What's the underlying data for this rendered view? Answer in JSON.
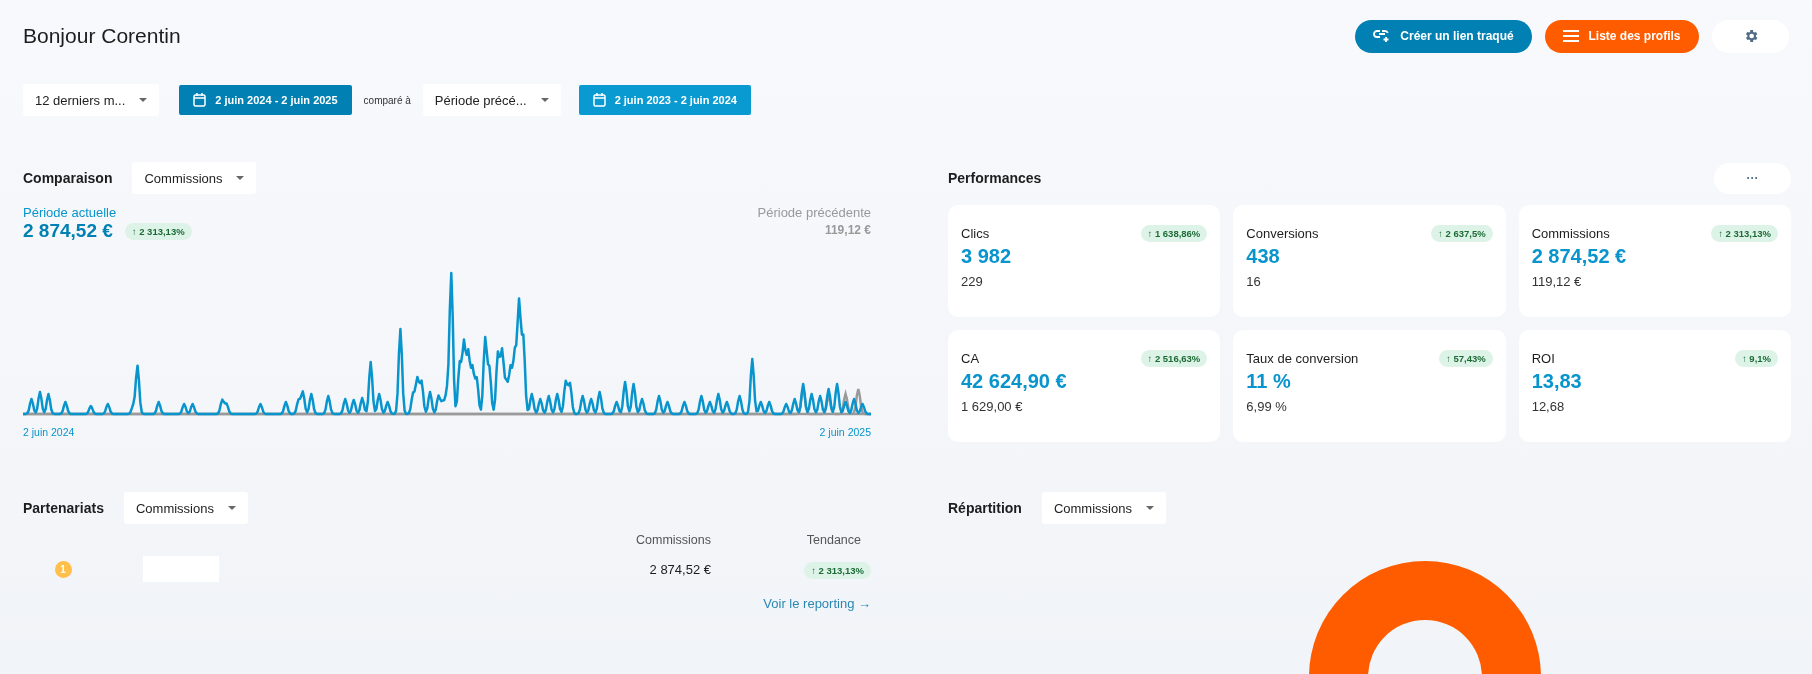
{
  "greeting": "Bonjour Corentin",
  "header_buttons": [
    {
      "kind": "link",
      "label": "Créer un lien traqué"
    },
    {
      "kind": "list",
      "label": "Liste des profils"
    },
    {
      "kind": "settings"
    }
  ],
  "filters": {
    "period_select": "12 derniers m...",
    "current_range": "2 juin 2024 - 2 juin 2025",
    "compare_label": "comparé à",
    "compare_select": "Période précé...",
    "previous_range": "2 juin 2023 - 2 juin 2024"
  },
  "comparison": {
    "title": "Comparaison",
    "metric_select": "Commissions",
    "current_label": "Période actuelle",
    "current_value": "2 874,52 €",
    "trend": "↑ 2 313,13%",
    "previous_label": "Période précédente",
    "previous_value": "119,12 €",
    "start_date": "2 juin 2024",
    "end_date": "2 juin 2025"
  },
  "performances": {
    "title": "Performances",
    "more_button": "···",
    "cards": [
      {
        "label": "Clics",
        "trend": "↑ 1 638,86%",
        "value": "3 982",
        "previous": "229"
      },
      {
        "label": "Conversions",
        "trend": "↑ 2 637,5%",
        "value": "438",
        "previous": "16"
      },
      {
        "label": "Commissions",
        "trend": "↑ 2 313,13%",
        "value": "2 874,52 €",
        "previous": "119,12 €"
      },
      {
        "label": "CA",
        "trend": "↑ 2 516,63%",
        "value": "42 624,90 €",
        "previous": "1 629,00 €"
      },
      {
        "label": "Taux de conversion",
        "trend": "↑ 57,43%",
        "value": "11 %",
        "previous": "6,99 %"
      },
      {
        "label": "ROI",
        "trend": "↑ 9,1%",
        "value": "13,83",
        "previous": "12,68"
      }
    ]
  },
  "partnerships": {
    "title": "Partenariats",
    "metric_select": "Commissions",
    "columns": [
      "Commissions",
      "Tendance"
    ],
    "rows": [
      {
        "rank": "1",
        "commissions": "2 874,52 €",
        "trend": "↑ 2 313,13%"
      }
    ],
    "report_link": "Voir le reporting →"
  },
  "distribution": {
    "title": "Répartition",
    "metric_select": "Commissions"
  }
}
